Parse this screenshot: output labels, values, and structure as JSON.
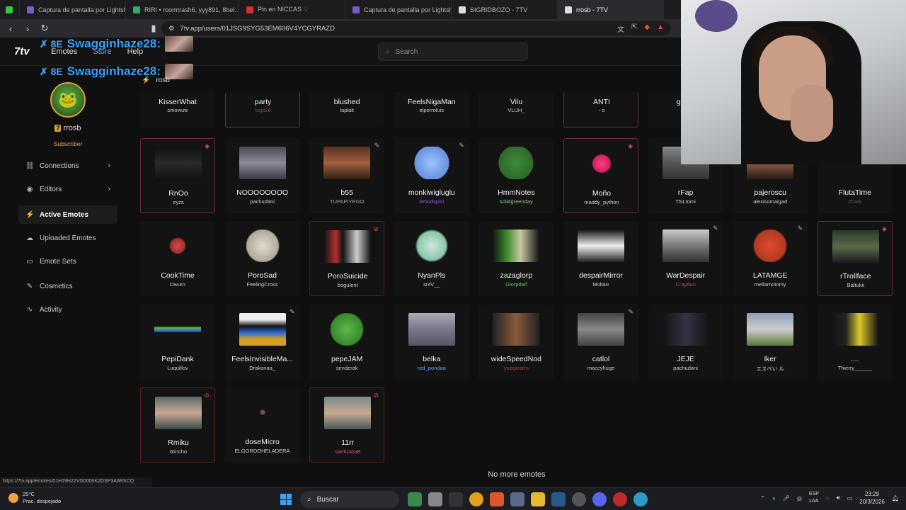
{
  "browser": {
    "tabs": [
      {
        "label": "Captura de pantalla por Lightshot",
        "color": "#7a5cc8"
      },
      {
        "label": "RIRI • roomtrash6, yyy891, 8bel...",
        "color": "#3aa36a"
      },
      {
        "label": "Pin en NICCAS ♡",
        "color": "#d03030"
      },
      {
        "label": "Captura de pantalla por Lightshot",
        "color": "#7a5cc8"
      },
      {
        "label": "SIGRIDBOZO - 7TV",
        "color": "#dddddd"
      },
      {
        "label": "rrosb - 7TV",
        "color": "#dddddd"
      }
    ],
    "url": "7tv.app/users/01JSG9SYG53EM606V4YCGYRAZD",
    "status_url": "https://7tv.app/emotes/01H19H22VG0006K2DSP3A6RSCQ"
  },
  "header": {
    "logo": "7tv",
    "nav": [
      "Emotes",
      "Store",
      "Help"
    ],
    "search_placeholder": "Search"
  },
  "chat": [
    {
      "user": "Swagginhaze28:",
      "badge": "✗ 8E"
    },
    {
      "user": "Swagginhaze28:",
      "badge": "✗ 8E"
    }
  ],
  "profile": {
    "set_name": "rosb",
    "username": "rrosb",
    "role": "Subscriber"
  },
  "sidebar": {
    "items": [
      {
        "label": "Connections",
        "icon": "link-icon",
        "glyph": "⛓",
        "chevron": true,
        "active": false
      },
      {
        "label": "Editors",
        "icon": "editors-icon",
        "glyph": "◉",
        "chevron": true,
        "active": false
      },
      {
        "label": "Active Emotes",
        "icon": "bolt-icon",
        "glyph": "⚡",
        "chevron": false,
        "active": true
      },
      {
        "label": "Uploaded Emotes",
        "icon": "upload-icon",
        "glyph": "☁",
        "chevron": false,
        "active": false
      },
      {
        "label": "Emote Sets",
        "icon": "folder-icon",
        "glyph": "▭",
        "chevron": false,
        "active": false
      },
      {
        "label": "Cosmetics",
        "icon": "brush-icon",
        "glyph": "✎",
        "chevron": false,
        "active": false
      },
      {
        "label": "Activity",
        "icon": "activity-icon",
        "glyph": "∿",
        "chevron": false,
        "active": false
      }
    ]
  },
  "emotes": [
    {
      "name": "KisserWhat",
      "owner": "smowuw",
      "corner": "",
      "style": "",
      "img": "#222",
      "ownerColor": "#cfcfcf"
    },
    {
      "name": "party",
      "owner": "baja28",
      "corner": "",
      "style": "outline-top",
      "img": "#222",
      "ownerColor": "#7a4a60"
    },
    {
      "name": "blushed",
      "owner": "laplait",
      "corner": "",
      "style": "",
      "img": "#222",
      "ownerColor": "#cfcfcf"
    },
    {
      "name": "FeelsNigaMan",
      "owner": "elperroluis",
      "corner": "",
      "style": "",
      "img": "#222",
      "ownerColor": "#cfcfcf"
    },
    {
      "name": "Vilu",
      "owner": "VLUH_",
      "corner": "",
      "style": "",
      "img": "#222",
      "ownerColor": "#cfcfcf"
    },
    {
      "name": "ANTI",
      "owner": "- o",
      "corner": "",
      "style": "outline-top",
      "img": "#222",
      "ownerColor": "#cfcfcf"
    },
    {
      "name": "gatoc",
      "owner": "sa",
      "corner": "",
      "style": "",
      "img": "#222",
      "ownerColor": "#cfcfcf"
    },
    {
      "name": "",
      "owner": "",
      "corner": "",
      "style": "",
      "img": "#131313",
      "ownerColor": "#cfcfcf"
    },
    {
      "name": "",
      "owner": "",
      "corner": "",
      "style": "",
      "img": "#131313",
      "ownerColor": "#cfcfcf"
    },
    {
      "name": "RnOo",
      "owner": "eyzs",
      "corner": "◈",
      "cornerClass": "pink",
      "style": "outline",
      "img": "linear-gradient(#111,#2a2a2a,#111)",
      "ownerColor": "#cfcfcf"
    },
    {
      "name": "NOOOOOOOO",
      "owner": "pachudani",
      "corner": "",
      "style": "",
      "img": "linear-gradient(#4a4a55,#8a8a99,#3a3a44)",
      "ownerColor": "#cfcfcf"
    },
    {
      "name": "b55",
      "owner": "TUPAPIYEGO",
      "corner": "✎",
      "style": "",
      "img": "linear-gradient(#5a3020,#a06040,#302010)",
      "ownerColor": "#a0a0a0"
    },
    {
      "name": "monkiwigluglu",
      "owner": "Woodspixl",
      "corner": "✎",
      "style": "",
      "img": "radial-gradient(circle,#9ac4ff 0%,#6a8fe0 60%,#131313 62%)",
      "ownerColor": "#8a5ad8"
    },
    {
      "name": "HmmNotes",
      "owner": "solidgreenday",
      "corner": "",
      "style": "",
      "img": "radial-gradient(circle,#3e8a3a 0%,#2c6a2a 60%,#131313 62%)",
      "ownerColor": "#9ac48a"
    },
    {
      "name": "Moño",
      "owner": "maddy_python",
      "corner": "◈",
      "cornerClass": "pink",
      "style": "outline",
      "img": "radial-gradient(circle,#ff3d8a 0%,#d0205a 30%,#131313 34%)",
      "ownerColor": "#cfcfcf"
    },
    {
      "name": "rFap",
      "owner": "TNLtomi",
      "corner": "",
      "style": "",
      "img": "linear-gradient(#888,#555,#333)",
      "ownerColor": "#cfcfcf"
    },
    {
      "name": "pajeroscu",
      "owner": "alexisomaigad",
      "corner": "",
      "style": "",
      "img": "linear-gradient(#2a1a14,#8a5a44,#2a1a14)",
      "ownerColor": "#cfcfcf"
    },
    {
      "name": "FlutaTime",
      "owner": "Zhark",
      "corner": "",
      "style": "",
      "img": "#131313",
      "ownerColor": "#555"
    },
    {
      "name": "CookTime",
      "owner": "Dwurn",
      "corner": "",
      "style": "",
      "img": "radial-gradient(circle,#d04a4a 0%,#a03030 25%,#131313 30%)",
      "ownerColor": "#cfcfcf"
    },
    {
      "name": "PoroSad",
      "owner": "FeelingCross",
      "corner": "",
      "style": "",
      "img": "radial-gradient(circle,#e0dcd0 0%,#b0aa9a 55%,#131313 60%)",
      "ownerColor": "#cfcfcf"
    },
    {
      "name": "PoroSuicide",
      "owner": "bogulent",
      "corner": "⊘",
      "cornerClass": "red",
      "style": "red",
      "img": "linear-gradient(90deg,#131313,#b03030 25%,#131313 40%,#ccc 70%,#131313)",
      "ownerColor": "#cfcfcf"
    },
    {
      "name": "NyanPls",
      "owner": "sntV__",
      "corner": "",
      "style": "",
      "img": "radial-gradient(circle,#cfe8d8 0%,#8ac8a8 50%,#131313 58%)",
      "ownerColor": "#cfcfcf"
    },
    {
      "name": "zazaglorp",
      "owner": "Glorpdalf",
      "corner": "",
      "style": "",
      "img": "linear-gradient(90deg,#131313,#3a8a2a 30%,#c8c8a0 60%,#131313)",
      "ownerColor": "#5ac85a"
    },
    {
      "name": "despairMirror",
      "owner": "Moltarr",
      "corner": "",
      "style": "",
      "img": "linear-gradient(#131313,#eee 50%,#222)",
      "ownerColor": "#cfcfcf"
    },
    {
      "name": "WarDespair",
      "owner": "Craydun",
      "corner": "✎",
      "style": "",
      "img": "linear-gradient(#ccc,#777,#333)",
      "ownerColor": "#c83a8a"
    },
    {
      "name": "LATAMGE",
      "owner": "mellamotomy",
      "corner": "✎",
      "style": "",
      "img": "radial-gradient(circle,#e04a30 0%,#b03a20 55%,#131313 60%)",
      "ownerColor": "#cfcfcf"
    },
    {
      "name": "rTrollface",
      "owner": "Baltukii",
      "corner": "◈",
      "cornerClass": "pink",
      "style": "outline",
      "img": "linear-gradient(#2a3a2a,#5a6a4a,#1a1a1a)",
      "ownerColor": "#cfcfcf"
    },
    {
      "name": "PepiDank",
      "owner": "Luquillov",
      "corner": "",
      "style": "",
      "img": "linear-gradient(#131313 40%,#5ab83a 45%,#3a6ad8 55%,#131313 60%)",
      "ownerColor": "#cfcfcf"
    },
    {
      "name": "FeelsInvisibleMa...",
      "owner": "Drakonaa_",
      "corner": "✎",
      "style": "",
      "img": "linear-gradient(#eee 20%,#131313 40%,#2a6ad8 60%,#d8a020 80%)",
      "ownerColor": "#cfcfcf"
    },
    {
      "name": "pepeJAM",
      "owner": "senderak",
      "corner": "",
      "style": "",
      "img": "radial-gradient(circle,#5ab84a 0%,#3a8a2a 55%,#131313 60%)",
      "ownerColor": "#cfcfcf"
    },
    {
      "name": "belka",
      "owner": "red_pondaa",
      "corner": "",
      "style": "",
      "img": "linear-gradient(#aab,#778,#556)",
      "ownerColor": "#5aa8ff"
    },
    {
      "name": "wideSpeedNod",
      "owner": "yoogiearm",
      "corner": "",
      "style": "",
      "img": "linear-gradient(90deg,#222,#8a5a3a,#222)",
      "ownerColor": "#c83a3a"
    },
    {
      "name": "catlol",
      "owner": "maccyhuge",
      "corner": "✎",
      "style": "",
      "img": "linear-gradient(#444,#888,#444)",
      "ownerColor": "#cfcfcf"
    },
    {
      "name": "JEJE",
      "owner": "pachudani",
      "corner": "",
      "style": "",
      "img": "linear-gradient(90deg,#131313,#334,#131313)",
      "ownerColor": "#cfcfcf"
    },
    {
      "name": "lker",
      "owner": "エスぺい ル",
      "corner": "",
      "style": "",
      "img": "linear-gradient(#8aa0b8,#ccc,#5a7a3a)",
      "ownerColor": "#cfcfcf"
    },
    {
      "name": "....",
      "owner": "Thierry______",
      "corner": "",
      "style": "",
      "img": "linear-gradient(90deg,#131313,#222,#d8c82a 60%,#131313)",
      "ownerColor": "#cfcfcf"
    },
    {
      "name": "Rmiku",
      "owner": "6tincho",
      "corner": "⊘",
      "cornerClass": "red",
      "style": "red",
      "img": "linear-gradient(#5a6a6a,#c8a890,#3a4a4a)",
      "ownerColor": "#cfcfcf"
    },
    {
      "name": "doseMicro",
      "owner": "ELGORDOHELADERA",
      "corner": "",
      "style": "",
      "img": "radial-gradient(circle,#8a6a4a 0%,#5a4a3a 8%,#131313 10%)",
      "ownerColor": "#cfcfcf"
    },
    {
      "name": "11rr",
      "owner": "santizaza8",
      "corner": "⊘",
      "cornerClass": "red",
      "style": "red",
      "img": "linear-gradient(#7a8a8a,#c8a890,#4a5a5a)",
      "ownerColor": "#d8508a"
    }
  ],
  "footer_text": "No more emotes",
  "taskbar": {
    "weather_temp": "25°C",
    "weather_desc": "Prac. despejado",
    "search": "Buscar",
    "lang_top": "ESP",
    "lang_bottom": "LAA",
    "time": "23:29",
    "date": "20/3/2026"
  }
}
